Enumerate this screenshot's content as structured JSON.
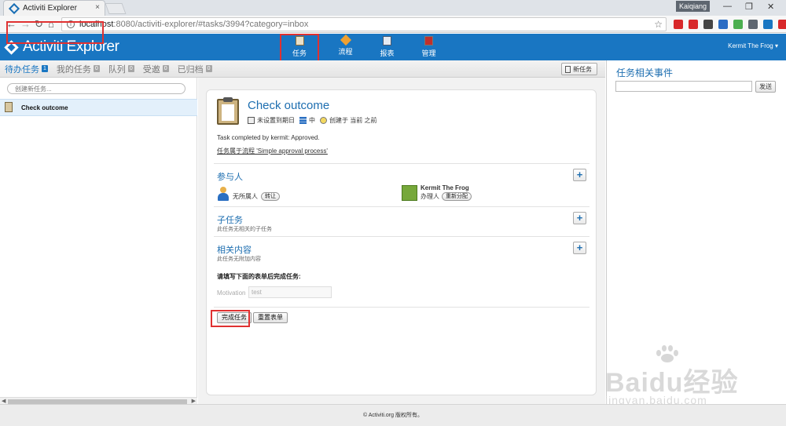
{
  "browser": {
    "tab_title": "Activiti Explorer",
    "tab_close": "×",
    "profile_name": "Kaiqiang",
    "url_host": "localhost",
    "url_rest": ":8080/activiti-explorer/#tasks/3994?category=inbox",
    "back": "←",
    "forward": "→",
    "reload": "↻",
    "home": "⌂",
    "star": "☆",
    "minimize": "—",
    "restore": "❐",
    "close": "✕",
    "extensions": [
      {
        "name": "abp-icon",
        "color": "#d8282a"
      },
      {
        "name": "opera-icon",
        "color": "#d8282a"
      },
      {
        "name": "evernote-icon",
        "color": "#444444"
      },
      {
        "name": "bookmark-icon",
        "color": "#2b6cc4"
      },
      {
        "name": "translate-icon",
        "color": "#4caf50"
      },
      {
        "name": "readability-icon",
        "color": "#5e6670"
      },
      {
        "name": "save-icon",
        "color": "#1976c2"
      },
      {
        "name": "adblock-icon",
        "color": "#d8282a"
      }
    ]
  },
  "app": {
    "logo_text": "Activiti Explorer",
    "nav": [
      {
        "label": "任务",
        "icon": "tasks-icon",
        "active": true,
        "color": "#e9e0c8"
      },
      {
        "label": "流程",
        "icon": "process-icon",
        "active": false,
        "color": "#f0a030"
      },
      {
        "label": "报表",
        "icon": "reports-icon",
        "active": false,
        "color": "#e4eaf2"
      },
      {
        "label": "管理",
        "icon": "manage-icon",
        "active": false,
        "color": "#c0302c"
      }
    ],
    "user_menu": "Kermit The Frog ▾"
  },
  "subnav": {
    "items": [
      {
        "label": "待办任务",
        "count": "1",
        "active": true
      },
      {
        "label": "我的任务",
        "count": "0",
        "active": false
      },
      {
        "label": "队列",
        "count": "0",
        "active": false
      },
      {
        "label": "受邀",
        "count": "0",
        "active": false
      },
      {
        "label": "已归档",
        "count": "0",
        "active": false
      }
    ],
    "new_task": "新任务"
  },
  "left": {
    "input_placeholder": "创建新任务...",
    "task": "Check outcome",
    "scroll_left": "◀",
    "scroll_right": "▶"
  },
  "task": {
    "title": "Check outcome",
    "meta_due": "未设置到期日",
    "meta_priority": "中",
    "meta_created": "创建于 当前 之前",
    "description": "Task completed by kermit: Approved.",
    "process_link": "任务属于流程 'Simple approval process'",
    "participants_title": "参与人",
    "no_owner": "无所属人",
    "transfer_btn": "转让",
    "assignee_name": "Kermit The Frog",
    "assignee_role": "办理人",
    "reassign_btn": "重新分配",
    "subtasks_title": "子任务",
    "subtasks_sub": "此任务无相关的子任务",
    "related_title": "相关内容",
    "related_sub": "此任务无附加内容",
    "plus": "+",
    "form_label": "请填写下面的表单后完成任务:",
    "motivation_label": "Motivation",
    "motivation_value": "test",
    "complete_btn": "完成任务",
    "reset_btn": "重置表单"
  },
  "right": {
    "title": "任务相关事件",
    "send_btn": "发送"
  },
  "footer": "© Activiti.org 版权所有。",
  "watermark": {
    "brand": "Baidu经验",
    "url": "jingyan.baidu.com"
  },
  "colors": {
    "header_blue": "#1976c2",
    "link_blue": "#1d6eb0",
    "highlight_red": "#e03131"
  }
}
